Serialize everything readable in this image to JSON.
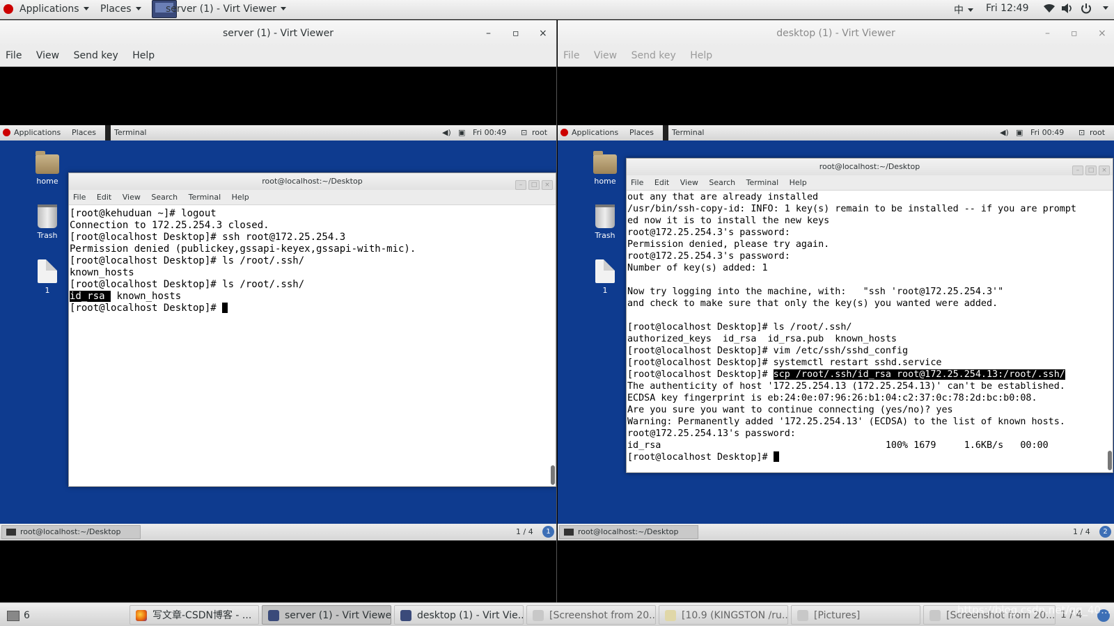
{
  "host_topbar": {
    "applications": "Applications",
    "places": "Places",
    "window": "server (1) - Virt Viewer",
    "input": "中",
    "clock": "Fri 12:49"
  },
  "left_viewer": {
    "title": "server (1) - Virt Viewer",
    "menu": [
      "File",
      "View",
      "Send key",
      "Help"
    ],
    "guest": {
      "applications": "Applications",
      "places": "Places",
      "terminal": "Terminal",
      "clock": "Fri 00:49",
      "user": "root",
      "desktop_icons": [
        "home",
        "Trash",
        "1"
      ],
      "terminal_title": "root@localhost:~/Desktop",
      "terminal_menu": [
        "File",
        "Edit",
        "View",
        "Search",
        "Terminal",
        "Help"
      ],
      "lines": [
        "[root@kehuduan ~]# logout",
        "Connection to 172.25.254.3 closed.",
        "[root@localhost Desktop]# ssh root@172.25.254.3",
        "Permission denied (publickey,gssapi-keyex,gssapi-with-mic).",
        "[root@localhost Desktop]# ls /root/.ssh/",
        "known_hosts",
        "[root@localhost Desktop]# ls /root/.ssh/"
      ],
      "sel_line_selected": "id_rsa ",
      "sel_line_rest": " known_hosts",
      "prompt": "[root@localhost Desktop]# ",
      "task": "root@localhost:~/Desktop",
      "pager": "1 / 4",
      "info": "1"
    }
  },
  "right_viewer": {
    "title": "desktop (1) - Virt Viewer",
    "menu": [
      "File",
      "View",
      "Send key",
      "Help"
    ],
    "guest": {
      "applications": "Applications",
      "places": "Places",
      "terminal": "Terminal",
      "clock": "Fri 00:49",
      "user": "root",
      "desktop_icons": [
        "home",
        "Trash",
        "1"
      ],
      "terminal_title": "root@localhost:~/Desktop",
      "terminal_menu": [
        "File",
        "Edit",
        "View",
        "Search",
        "Terminal",
        "Help"
      ],
      "lines_before": [
        "out any that are already installed",
        "/usr/bin/ssh-copy-id: INFO: 1 key(s) remain to be installed -- if you are prompt",
        "ed now it is to install the new keys",
        "root@172.25.254.3's password:",
        "Permission denied, please try again.",
        "root@172.25.254.3's password:",
        "",
        "Number of key(s) added: 1",
        "",
        "Now try logging into the machine, with:   \"ssh 'root@172.25.254.3'\"",
        "and check to make sure that only the key(s) you wanted were added.",
        "",
        "[root@localhost Desktop]# ls /root/.ssh/",
        "authorized_keys  id_rsa  id_rsa.pub  known_hosts",
        "[root@localhost Desktop]# vim /etc/ssh/sshd_config",
        "[root@localhost Desktop]# systemctl restart sshd.service"
      ],
      "scp_prompt": "[root@localhost Desktop]# ",
      "scp_cmd": "scp /root/.ssh/id_rsa root@172.25.254.13:/root/.ssh/",
      "lines_after": [
        "The authenticity of host '172.25.254.13 (172.25.254.13)' can't be established.",
        "ECDSA key fingerprint is eb:24:0e:07:96:26:b1:04:c2:37:0c:78:2d:bc:b0:08.",
        "Are you sure you want to continue connecting (yes/no)? yes",
        "Warning: Permanently added '172.25.254.13' (ECDSA) to the list of known hosts.",
        "root@172.25.254.13's password:",
        "id_rsa                                        100% 1679     1.6KB/s   00:00"
      ],
      "prompt": "[root@localhost Desktop]# ",
      "task": "root@localhost:~/Desktop",
      "pager": "1 / 4",
      "info": "2"
    }
  },
  "taskbar": {
    "workspace": "6",
    "items": [
      "写文章-CSDN博客 - ...",
      "server (1) - Virt Viewer",
      "desktop (1) - Virt Vie...",
      "[Screenshot from 20...",
      "[10.9 (KINGSTON /ru...",
      "[Pictures]",
      "[Screenshot from 20..."
    ],
    "pager": "1 / 4",
    "watermark": "https://blog.csdn.net/qq_40..."
  },
  "colors": {
    "guest_desktop": "#0e3b8f",
    "selection": "#000000"
  }
}
